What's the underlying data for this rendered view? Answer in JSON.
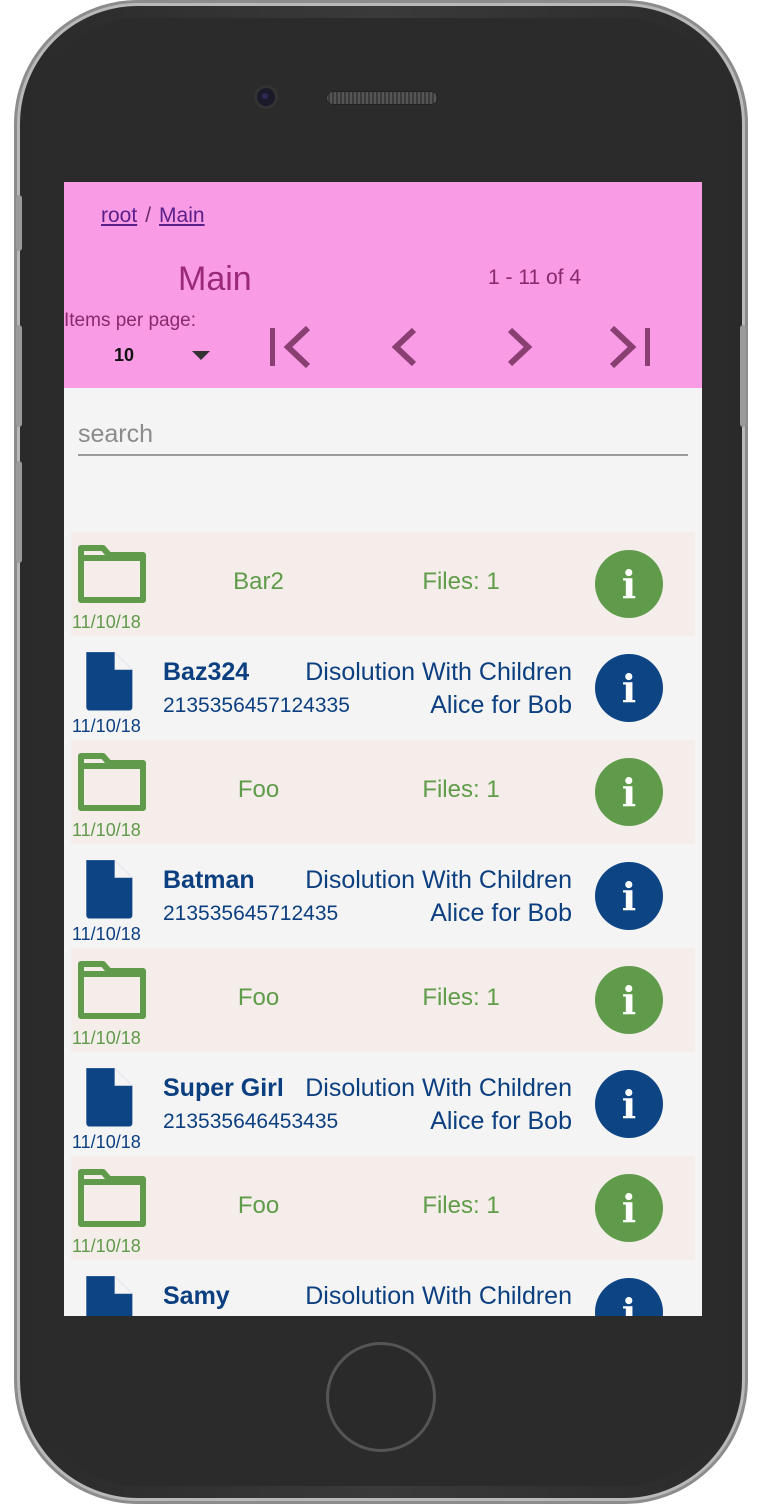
{
  "breadcrumb": {
    "items": [
      "root",
      "Main"
    ],
    "separator": "/"
  },
  "header": {
    "title": "Main",
    "range": "1 - 11 of 4",
    "items_per_page_label": "Items per page:",
    "items_per_page_value": "10",
    "accent": "#f99be5"
  },
  "search": {
    "placeholder": "search"
  },
  "list": [
    {
      "kind": "folder",
      "name": "Bar2",
      "files": "Files: 1",
      "date": "11/10/18"
    },
    {
      "kind": "file",
      "name": "Baz324",
      "number": "2135356457124335",
      "type": "Disolution With Children",
      "parties": "Alice for Bob",
      "date": "11/10/18"
    },
    {
      "kind": "folder",
      "name": "Foo",
      "files": "Files: 1",
      "date": "11/10/18"
    },
    {
      "kind": "file",
      "name": "Batman",
      "number": "213535645712435",
      "type": "Disolution With Children",
      "parties": "Alice for Bob",
      "date": "11/10/18"
    },
    {
      "kind": "folder",
      "name": "Foo",
      "files": "Files: 1",
      "date": "11/10/18"
    },
    {
      "kind": "file",
      "name": "Super Girl",
      "number": "213535646453435",
      "type": "Disolution With Children",
      "parties": "Alice for Bob",
      "date": "11/10/18"
    },
    {
      "kind": "folder",
      "name": "Foo",
      "files": "Files: 1",
      "date": "11/10/18"
    },
    {
      "kind": "file",
      "name": "Samy",
      "number": "",
      "type": "Disolution With Children",
      "parties": "",
      "date": ""
    }
  ],
  "icons": {
    "folder": "folder-outline-icon",
    "file": "document-icon",
    "info": "info-icon",
    "first": "first-page-icon",
    "prev": "chevron-left-icon",
    "next": "chevron-right-icon",
    "last": "last-page-icon"
  },
  "colors": {
    "folder_green": "#5f9b4a",
    "file_blue": "#0c3f80",
    "title_purple": "#9a2a79"
  }
}
